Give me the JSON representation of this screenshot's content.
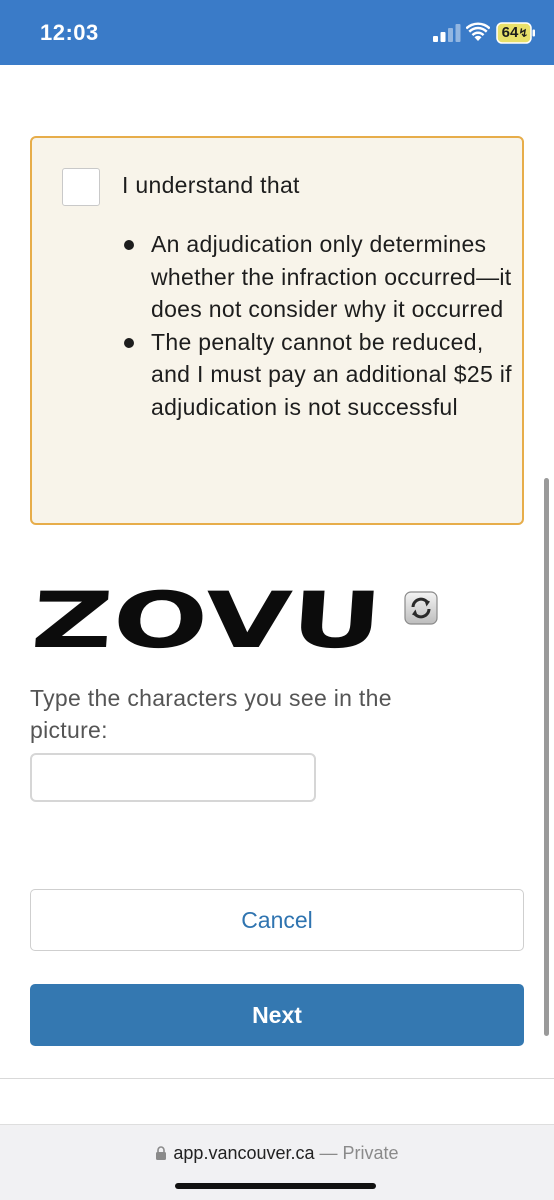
{
  "status_bar": {
    "time": "12:03",
    "battery": "64",
    "background": "#3a7bc8"
  },
  "acknowledgement": {
    "heading": "I understand that",
    "items": [
      "An adjudication only determines whether the infraction occurred—it does not consider why it occurred",
      "The penalty cannot be reduced, and I must pay an additional $25 if adjudication is not successful"
    ],
    "checked": false,
    "background": "#f8f4ea",
    "border_color": "#e7ad4a"
  },
  "captcha": {
    "image_text": "ZOVU",
    "refresh_icon": "refresh-icon",
    "label": "Type the characters you see in the picture:",
    "input_value": ""
  },
  "buttons": {
    "cancel_label": "Cancel",
    "next_label": "Next",
    "accent": "#3478b1"
  },
  "browser": {
    "url": "app.vancouver.ca",
    "separator": "—",
    "mode": "Private",
    "lock_icon": "lock-icon"
  }
}
